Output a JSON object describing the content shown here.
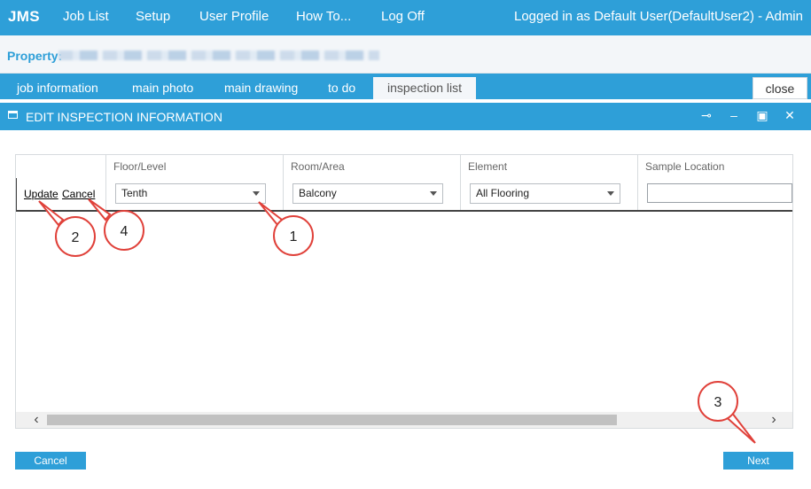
{
  "app": {
    "brand": "JMS"
  },
  "nav": {
    "items": [
      "Job List",
      "Setup",
      "User Profile",
      "How To...",
      "Log Off"
    ],
    "login_text": "Logged in as Default User(DefaultUser2) - Admin"
  },
  "property": {
    "label": "Property:"
  },
  "tabs": {
    "items": [
      "job information",
      "main photo",
      "main drawing",
      "to do",
      "inspection list"
    ],
    "active": "inspection list",
    "close_label": "close"
  },
  "dialog": {
    "title": "EDIT INSPECTION INFORMATION",
    "controls": {
      "pin": "⊸",
      "minimize": "–",
      "maximize": "▣",
      "close": "✕"
    }
  },
  "grid": {
    "columns": [
      "",
      "Floor/Level",
      "Room/Area",
      "Element",
      "Sample Location"
    ],
    "row": {
      "update_label": "Update",
      "cancel_label": "Cancel",
      "floor": "Tenth",
      "room": "Balcony",
      "element": "All Flooring",
      "sample_location": ""
    },
    "scroll": {
      "left": "‹",
      "right": "›"
    }
  },
  "buttons": {
    "cancel": "Cancel",
    "next": "Next"
  },
  "callouts": [
    "1",
    "2",
    "3",
    "4"
  ],
  "colors": {
    "accent": "#2e9fd8",
    "callout": "#e0413a"
  }
}
